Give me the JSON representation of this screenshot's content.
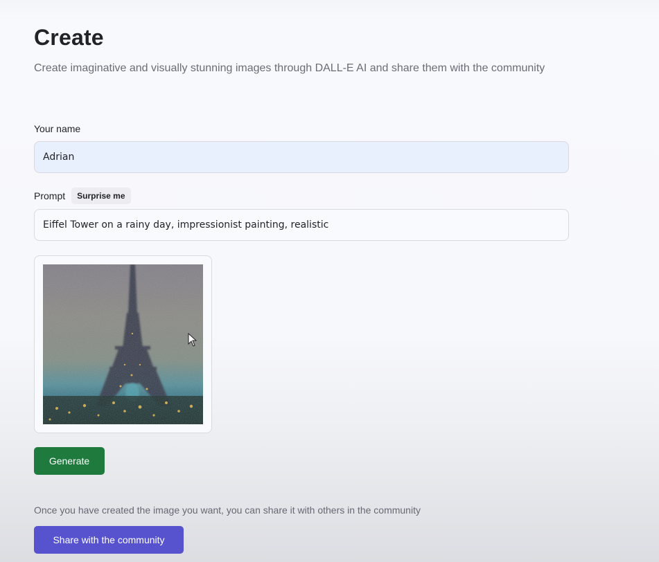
{
  "header": {
    "title": "Create",
    "subtitle": "Create imaginative and visually stunning images through DALL-E AI and share them with the community"
  },
  "form": {
    "name_label": "Your name",
    "name_value": "Adrian",
    "prompt_label": "Prompt",
    "surprise_label": "Surprise me",
    "prompt_value": "Eiffel Tower on a rainy day, impressionist painting, realistic",
    "generated_image_alt": "Eiffel Tower on a rainy day, impressionist painting, realistic"
  },
  "actions": {
    "generate_label": "Generate",
    "share_note": "Once you have created the image you want, you can share it with others in the community",
    "share_label": "Share with the community"
  },
  "colors": {
    "generate": "#1f7a3e",
    "share": "#5753cf",
    "name_field": "#e8effd"
  },
  "icons": {
    "cursor": "mouse-pointer-icon"
  }
}
